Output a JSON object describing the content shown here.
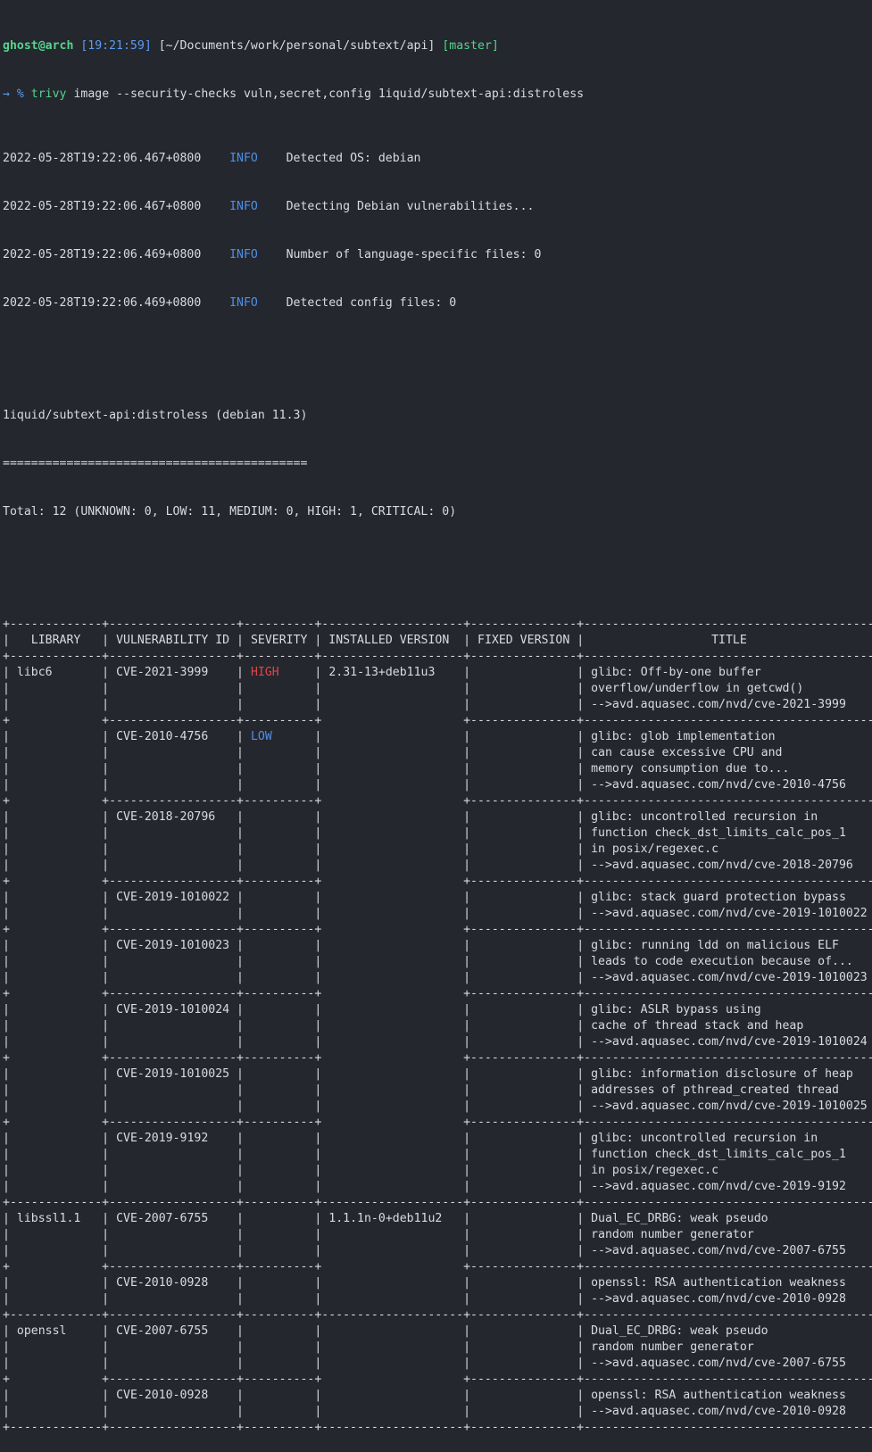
{
  "colors": {
    "background": "#24272e",
    "foreground": "#d9dbe0",
    "prompt_user": "#57d38c",
    "prompt_time": "#5b9cf0",
    "info": "#4e8fe6",
    "high": "#e0454a",
    "low": "#4e8fe6"
  },
  "prompt": {
    "user_host": "ghost@arch",
    "time": "[19:21:59]",
    "path": "[~/Documents/work/personal/subtext/api]",
    "branch": "[master]",
    "arrow": "→ %",
    "command": "trivy",
    "args": "image --security-checks vuln,secret,config 1iquid/subtext-api:distroless"
  },
  "logs": [
    {
      "timestamp": "2022-05-28T19:22:06.467+0800",
      "level": "INFO",
      "message": "Detected OS: debian"
    },
    {
      "timestamp": "2022-05-28T19:22:06.467+0800",
      "level": "INFO",
      "message": "Detecting Debian vulnerabilities..."
    },
    {
      "timestamp": "2022-05-28T19:22:06.469+0800",
      "level": "INFO",
      "message": "Number of language-specific files: 0"
    },
    {
      "timestamp": "2022-05-28T19:22:06.469+0800",
      "level": "INFO",
      "message": "Detected config files: 0"
    }
  ],
  "report": {
    "target": "1iquid/subtext-api:distroless (debian 11.3)",
    "underline": "===========================================",
    "total": "Total: 12 (UNKNOWN: 0, LOW: 11, MEDIUM: 0, HIGH: 1, CRITICAL: 0)"
  },
  "table": {
    "headers": [
      "LIBRARY",
      "VULNERABILITY ID",
      "SEVERITY",
      "INSTALLED VERSION",
      "FIXED VERSION",
      "TITLE"
    ],
    "rows": [
      {
        "library": "libc6",
        "vuln_id": "CVE-2021-3999",
        "severity": "HIGH",
        "installed": "2.31-13+deb11u3",
        "fixed": "",
        "title": [
          "glibc: Off-by-one buffer",
          "overflow/underflow in getcwd()",
          "-->avd.aquasec.com/nvd/cve-2021-3999"
        ],
        "lib_continues": false
      },
      {
        "library": "",
        "vuln_id": "CVE-2010-4756",
        "severity": "LOW",
        "installed": "",
        "fixed": "",
        "title": [
          "glibc: glob implementation",
          "can cause excessive CPU and",
          "memory consumption due to...",
          "-->avd.aquasec.com/nvd/cve-2010-4756"
        ],
        "lib_continues": true
      },
      {
        "library": "",
        "vuln_id": "CVE-2018-20796",
        "severity": "",
        "installed": "",
        "fixed": "",
        "title": [
          "glibc: uncontrolled recursion in",
          "function check_dst_limits_calc_pos_1",
          "in posix/regexec.c",
          "-->avd.aquasec.com/nvd/cve-2018-20796"
        ],
        "lib_continues": true
      },
      {
        "library": "",
        "vuln_id": "CVE-2019-1010022",
        "severity": "",
        "installed": "",
        "fixed": "",
        "title": [
          "glibc: stack guard protection bypass",
          "-->avd.aquasec.com/nvd/cve-2019-1010022"
        ],
        "lib_continues": true
      },
      {
        "library": "",
        "vuln_id": "CVE-2019-1010023",
        "severity": "",
        "installed": "",
        "fixed": "",
        "title": [
          "glibc: running ldd on malicious ELF",
          "leads to code execution because of...",
          "-->avd.aquasec.com/nvd/cve-2019-1010023"
        ],
        "lib_continues": true
      },
      {
        "library": "",
        "vuln_id": "CVE-2019-1010024",
        "severity": "",
        "installed": "",
        "fixed": "",
        "title": [
          "glibc: ASLR bypass using",
          "cache of thread stack and heap",
          "-->avd.aquasec.com/nvd/cve-2019-1010024"
        ],
        "lib_continues": true
      },
      {
        "library": "",
        "vuln_id": "CVE-2019-1010025",
        "severity": "",
        "installed": "",
        "fixed": "",
        "title": [
          "glibc: information disclosure of heap",
          "addresses of pthread_created thread",
          "-->avd.aquasec.com/nvd/cve-2019-1010025"
        ],
        "lib_continues": true
      },
      {
        "library": "",
        "vuln_id": "CVE-2019-9192",
        "severity": "",
        "installed": "",
        "fixed": "",
        "title": [
          "glibc: uncontrolled recursion in",
          "function check_dst_limits_calc_pos_1",
          "in posix/regexec.c",
          "-->avd.aquasec.com/nvd/cve-2019-9192"
        ],
        "lib_continues": true
      },
      {
        "library": "libssl1.1",
        "vuln_id": "CVE-2007-6755",
        "severity": "",
        "installed": "1.1.1n-0+deb11u2",
        "fixed": "",
        "title": [
          "Dual_EC_DRBG: weak pseudo",
          "random number generator",
          "-->avd.aquasec.com/nvd/cve-2007-6755"
        ],
        "lib_continues": false
      },
      {
        "library": "",
        "vuln_id": "CVE-2010-0928",
        "severity": "",
        "installed": "",
        "fixed": "",
        "title": [
          "openssl: RSA authentication weakness",
          "-->avd.aquasec.com/nvd/cve-2010-0928"
        ],
        "lib_continues": true
      },
      {
        "library": "openssl",
        "vuln_id": "CVE-2007-6755",
        "severity": "",
        "installed": "",
        "fixed": "",
        "title": [
          "Dual_EC_DRBG: weak pseudo",
          "random number generator",
          "-->avd.aquasec.com/nvd/cve-2007-6755"
        ],
        "lib_continues": false
      },
      {
        "library": "",
        "vuln_id": "CVE-2010-0928",
        "severity": "",
        "installed": "",
        "fixed": "",
        "title": [
          "openssl: RSA authentication weakness",
          "-->avd.aquasec.com/nvd/cve-2010-0928"
        ],
        "lib_continues": true
      }
    ]
  }
}
